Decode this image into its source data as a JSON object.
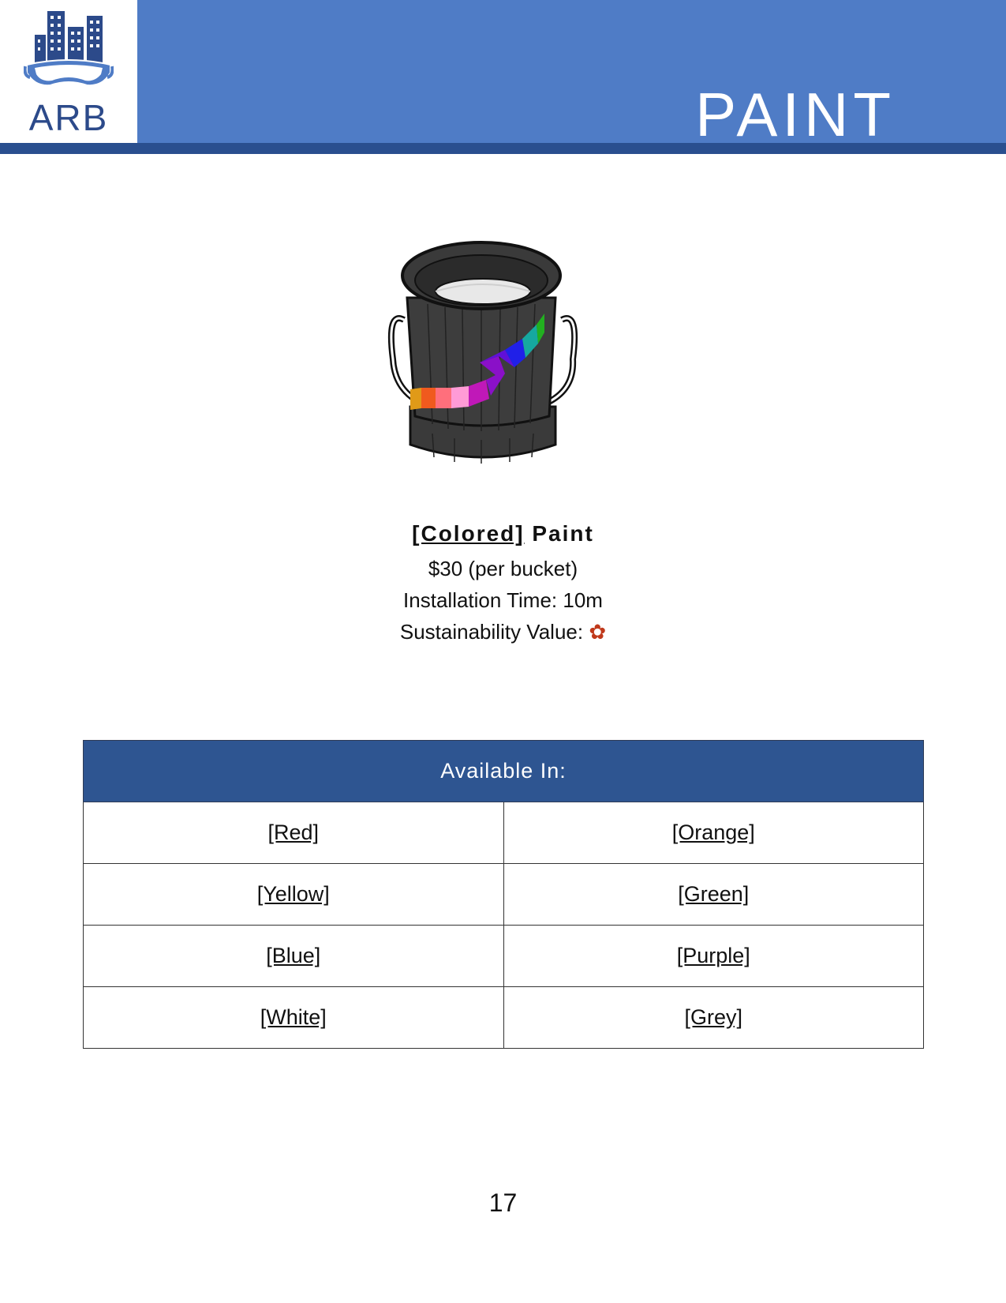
{
  "logo": {
    "text": "ARB",
    "icon": "city-skyline-goggles-icon"
  },
  "header": {
    "title": "PAINT"
  },
  "product": {
    "image_icon": "paint-bucket-icon",
    "name_bracket": "[Colored]",
    "name_rest": "Paint",
    "price": "$30 (per bucket)",
    "installation": "Installation Time: 10m",
    "sustainability_label": "Sustainability Value:",
    "sustainability_icon": "flower-icon",
    "sustainability_symbol": "✿"
  },
  "table": {
    "header": "Available In:",
    "rows": [
      [
        "[Red]",
        "[Orange]"
      ],
      [
        "[Yellow]",
        "[Green]"
      ],
      [
        "[Blue]",
        "[Purple]"
      ],
      [
        "[White]",
        "[Grey]"
      ]
    ]
  },
  "page_number": "17",
  "colors": {
    "header_blue": "#4f7cc6",
    "dark_blue": "#2a4f8f",
    "table_header": "#2e5591",
    "flower": "#c0391b"
  }
}
